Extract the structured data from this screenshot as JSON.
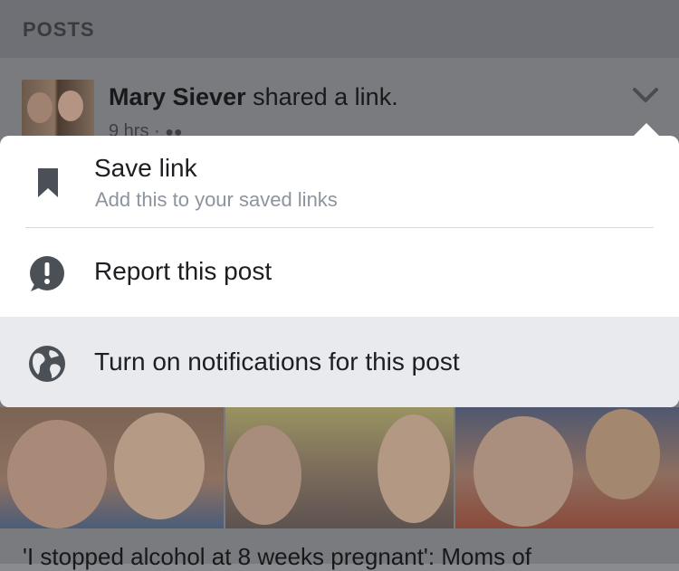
{
  "section": {
    "title": "POSTS"
  },
  "post": {
    "author": "Mary Siever",
    "action": " shared a link.",
    "meta": "9 hrs · ",
    "headline": "'I stopped alcohol at 8 weeks pregnant': Moms of"
  },
  "menu": {
    "items": [
      {
        "label": "Save link",
        "sublabel": "Add this to your saved links",
        "icon": "bookmark-icon"
      },
      {
        "label": "Report this post",
        "icon": "alert-bubble-icon"
      },
      {
        "label": "Turn on notifications for this post",
        "icon": "globe-icon"
      }
    ]
  },
  "colors": {
    "menu_bg": "#ffffff",
    "highlight_bg": "#e9eaed",
    "icon": "#4b4f56",
    "overlay": "#8a8b8f"
  }
}
